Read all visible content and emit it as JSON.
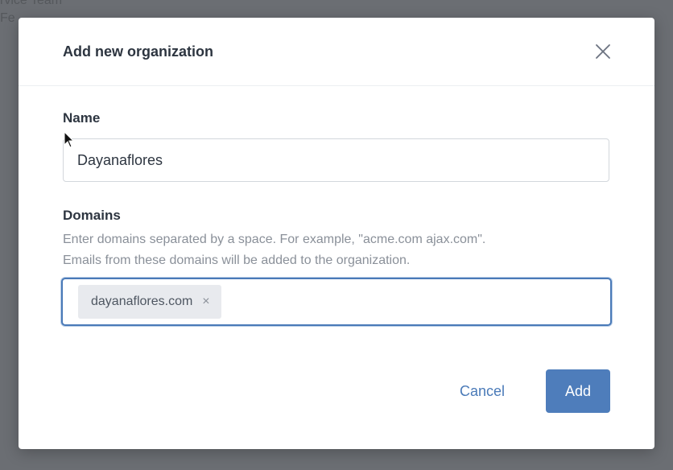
{
  "background": {
    "line1": "rvice Team",
    "line2": "Fe"
  },
  "dialog": {
    "title": "Add new organization",
    "close_icon": "close-icon",
    "name_field": {
      "label": "Name",
      "value": "Dayanaflores"
    },
    "domains_field": {
      "label": "Domains",
      "help_line1": "Enter domains separated by a space. For example, \"acme.com ajax.com\".",
      "help_line2": "Emails from these domains will be added to the organization.",
      "tags": [
        {
          "label": "dayanaflores.com",
          "remove_icon": "×"
        }
      ],
      "entry_value": ""
    },
    "cancel_label": "Cancel",
    "add_label": "Add"
  },
  "colors": {
    "accent": "#4e7dbb",
    "title_text": "#2d3540",
    "help_text": "#8a9099",
    "tag_background": "#e8eaee"
  }
}
